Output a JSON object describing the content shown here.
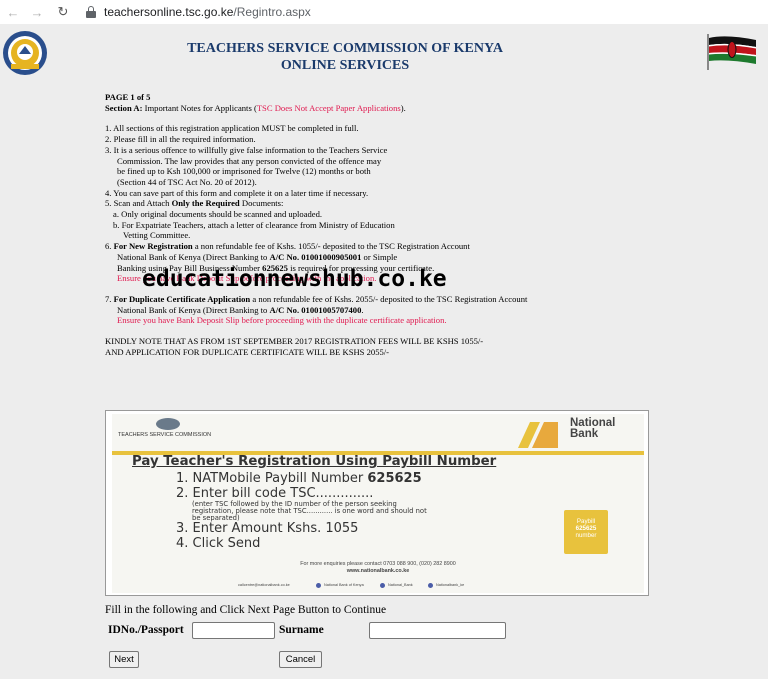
{
  "browser": {
    "url_domain": "teachersonline.tsc.go.ke",
    "url_path": "/Regintro.aspx"
  },
  "header": {
    "line1": "TEACHERS SERVICE COMMISSION OF KENYA",
    "line2": "ONLINE SERVICES"
  },
  "content": {
    "page_indicator": "PAGE 1 of 5",
    "section_label": "Section A:",
    "section_text": " Important Notes for Applicants (",
    "section_red": "TSC Does Not Accept Paper Applications",
    "section_end": ").",
    "item1": "1.  All sections of this registration application MUST be completed in full.",
    "item2": "2.  Please fill in all the required information.",
    "item3_l1": "3.  It is a serious offence to willfully give false information to the Teachers Service",
    "item3_l2": "Commission. The law provides that any person convicted of the offence may",
    "item3_l3": "be fined up to Ksh 100,000 or imprisoned for Twelve (12) months or both",
    "item3_l4": "(Section 44 of TSC Act No. 20 of 2012).",
    "item4": "4.  You can save part of this form and complete it on a later time if necessary.",
    "item5_a": "5.  Scan and Attach ",
    "item5_b": "Only the  Required",
    "item5_c": " Documents:",
    "item5a": "a. Only original documents should be scanned and uploaded.",
    "item5b_l1": "b. For Expatriate Teachers, attach a letter of clearance from Ministry of Education",
    "item5b_l2": "Vetting Committee.",
    "item6_num": "6.  ",
    "item6_bold": "For New Registration",
    "item6_rest": " a non refundable fee of Kshs. 1055/- deposited to the TSC Registration Account",
    "item6_l2_a": "National Bank of Kenya (Direct Banking to ",
    "item6_l2_b": "A/C No. 01001000905001",
    "item6_l2_c": " or Simple",
    "item6_l3_a": "Banking using Pay Bill Business Number ",
    "item6_l3_b": "625625",
    "item6_l3_c": " is required for processing your certificate.",
    "item6_red": "Ensure you have Bank Deposit Slip before proceeding with the application.",
    "item7_num": "7.  ",
    "item7_bold": "For Duplicate Certificate Application",
    "item7_rest": " a non refundable fee of Kshs. 2055/- deposited to the TSC Registration Account",
    "item7_l2_a": "National Bank of Kenya (Direct Banking to ",
    "item7_l2_b": "A/C No. 01001005707400",
    "item7_l2_c": ".",
    "item7_red": "Ensure you have Bank Deposit Slip before proceeding with the duplicate certificate application.",
    "notice_l1": "KINDLY NOTE THAT AS FROM 1ST SEPTEMBER 2017 REGISTRATION FEES WILL BE KSHS 1055/-",
    "notice_l2": "AND APPLICATION FOR DUPLICATE CERTIFICATE WILL BE KSHS 2055/-"
  },
  "watermark": "educationnewshub.co.ke",
  "poster": {
    "tsc_label": "TEACHERS SERVICE COMMISSION",
    "bank_l1": "National",
    "bank_l2": "Bank",
    "title": "Pay Teacher's Registration Using Paybill Number",
    "step1_a": "1. NATMobile Paybill Number ",
    "step1_b": "625625",
    "step2": "2. Enter bill code TSC..............",
    "step2_note1": "(enter TSC followed by the ID number of the person seeking",
    "step2_note2": "registration, please note that TSC............ is one word and should not",
    "step2_note3": "be separated)",
    "step3": "3. Enter Amount Kshs. 1055",
    "step4": "4. Click Send",
    "box_l1": "Paybill",
    "box_l2": "625625",
    "box_l3": "number",
    "enquiries": "For more enquiries please contact  0703 088 900, (020) 282 8900",
    "website": "www.nationalbank.co.ke",
    "foot_email": "callcentre@nationalbank.co.ke",
    "foot_fb": "National Bank of Kenya",
    "foot_tw": "National_Bank",
    "foot_ig": "Nationalbank_ke"
  },
  "form": {
    "instruction": "Fill in the following and Click Next Page Button to Continue",
    "id_label": "IDNo./Passport",
    "surname_label": "Surname",
    "id_value": "",
    "surname_value": "",
    "next_label": "Next",
    "cancel_label": "Cancel"
  },
  "colors": {
    "header_navy": "#1a3a6b",
    "alert_red": "#e0194f",
    "bank_gold": "#e8c23d"
  }
}
